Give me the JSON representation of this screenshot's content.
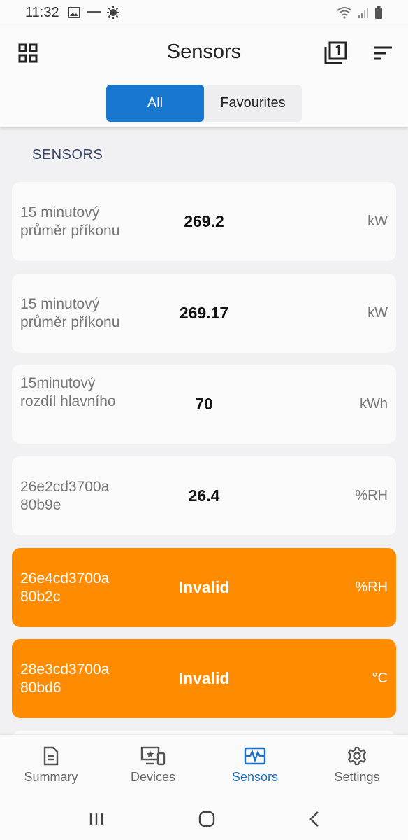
{
  "status_bar": {
    "time": "11:32"
  },
  "header": {
    "title": "Sensors"
  },
  "tabs": [
    {
      "label": "All",
      "active": true
    },
    {
      "label": "Favourites",
      "active": false
    }
  ],
  "section_title": "SENSORS",
  "sensors": [
    {
      "name": "15 minutový průměr příkonu",
      "value": "269.2",
      "unit": "kW",
      "state": "normal"
    },
    {
      "name": "15 minutový průměr příkonu",
      "value": "269.17",
      "unit": "kW",
      "state": "normal"
    },
    {
      "name": "15minutový rozdíl hlavního",
      "value": "70",
      "unit": "kWh",
      "state": "normal"
    },
    {
      "name": "26e2cd3700a 80b9e",
      "value": "26.4",
      "unit": "%RH",
      "state": "normal"
    },
    {
      "name": "26e4cd3700a 80b2c",
      "value": "Invalid",
      "unit": "%RH",
      "state": "invalid"
    },
    {
      "name": "28e3cd3700a 80bd6",
      "value": "Invalid",
      "unit": "°C",
      "state": "invalid"
    }
  ],
  "bottom_nav": [
    {
      "label": "Summary",
      "icon": "document-icon",
      "active": false
    },
    {
      "label": "Devices",
      "icon": "devices-icon",
      "active": false
    },
    {
      "label": "Sensors",
      "icon": "sensor-wave-icon",
      "active": true
    },
    {
      "label": "Settings",
      "icon": "gear-icon",
      "active": false
    }
  ],
  "colors": {
    "accent": "#1878d0",
    "invalid": "#ff8c00",
    "nav_active": "#1a73c4"
  }
}
